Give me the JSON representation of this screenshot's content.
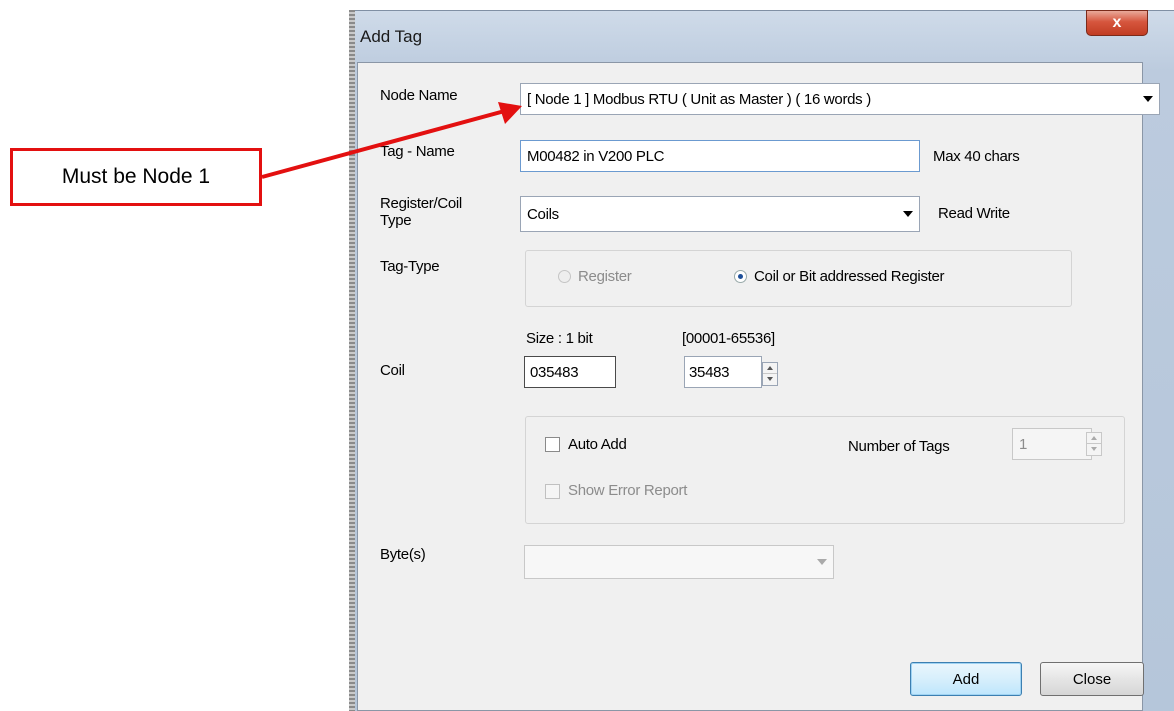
{
  "callout": {
    "text": "Must be Node 1",
    "color": "#e31010"
  },
  "window": {
    "title": "Add Tag",
    "close_symbol": "x"
  },
  "form": {
    "node_name_label": "Node Name",
    "node_name_value": "[ Node 1 ] Modbus RTU ( Unit as Master ) ( 16 words )",
    "tag_name_label": "Tag - Name",
    "tag_name_value": "M00482 in V200 PLC",
    "tag_name_hint": "Max 40 chars",
    "register_type_label_1": "Register/Coil",
    "register_type_label_2": "Type",
    "register_type_value": "Coils",
    "register_type_hint": "Read Write",
    "tag_type_label": "Tag-Type",
    "radio_register_label": "Register",
    "radio_coil_label": "Coil or Bit addressed Register",
    "size_label": "Size : 1 bit",
    "range_label": "[00001-65536]",
    "coil_label": "Coil",
    "coil_address": "035483",
    "coil_number": "35483",
    "auto_add_label": "Auto Add",
    "number_of_tags_label": "Number of Tags",
    "number_of_tags_value": "1",
    "show_error_label": "Show Error Report",
    "bytes_label": "Byte(s)",
    "bytes_value": ""
  },
  "buttons": {
    "add": "Add",
    "close": "Close"
  }
}
